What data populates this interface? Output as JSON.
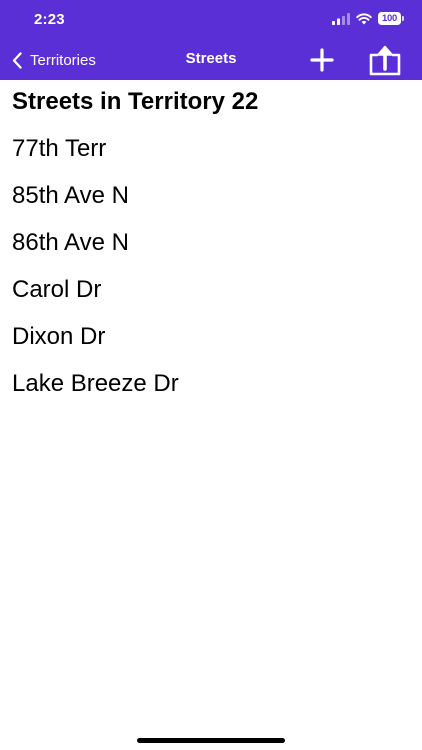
{
  "status_bar": {
    "time": "2:23",
    "battery": "100"
  },
  "nav": {
    "back_label": "Territories",
    "title": "Streets",
    "accent_color": "#5b2fd6",
    "icons": {
      "back": "chevron-left-icon",
      "add": "plus-icon",
      "share": "share-icon"
    }
  },
  "list": {
    "heading": "Streets in Territory 22",
    "streets": [
      "77th Terr",
      "85th Ave N",
      "86th Ave N",
      "Carol Dr",
      "Dixon Dr",
      "Lake Breeze Dr"
    ]
  }
}
